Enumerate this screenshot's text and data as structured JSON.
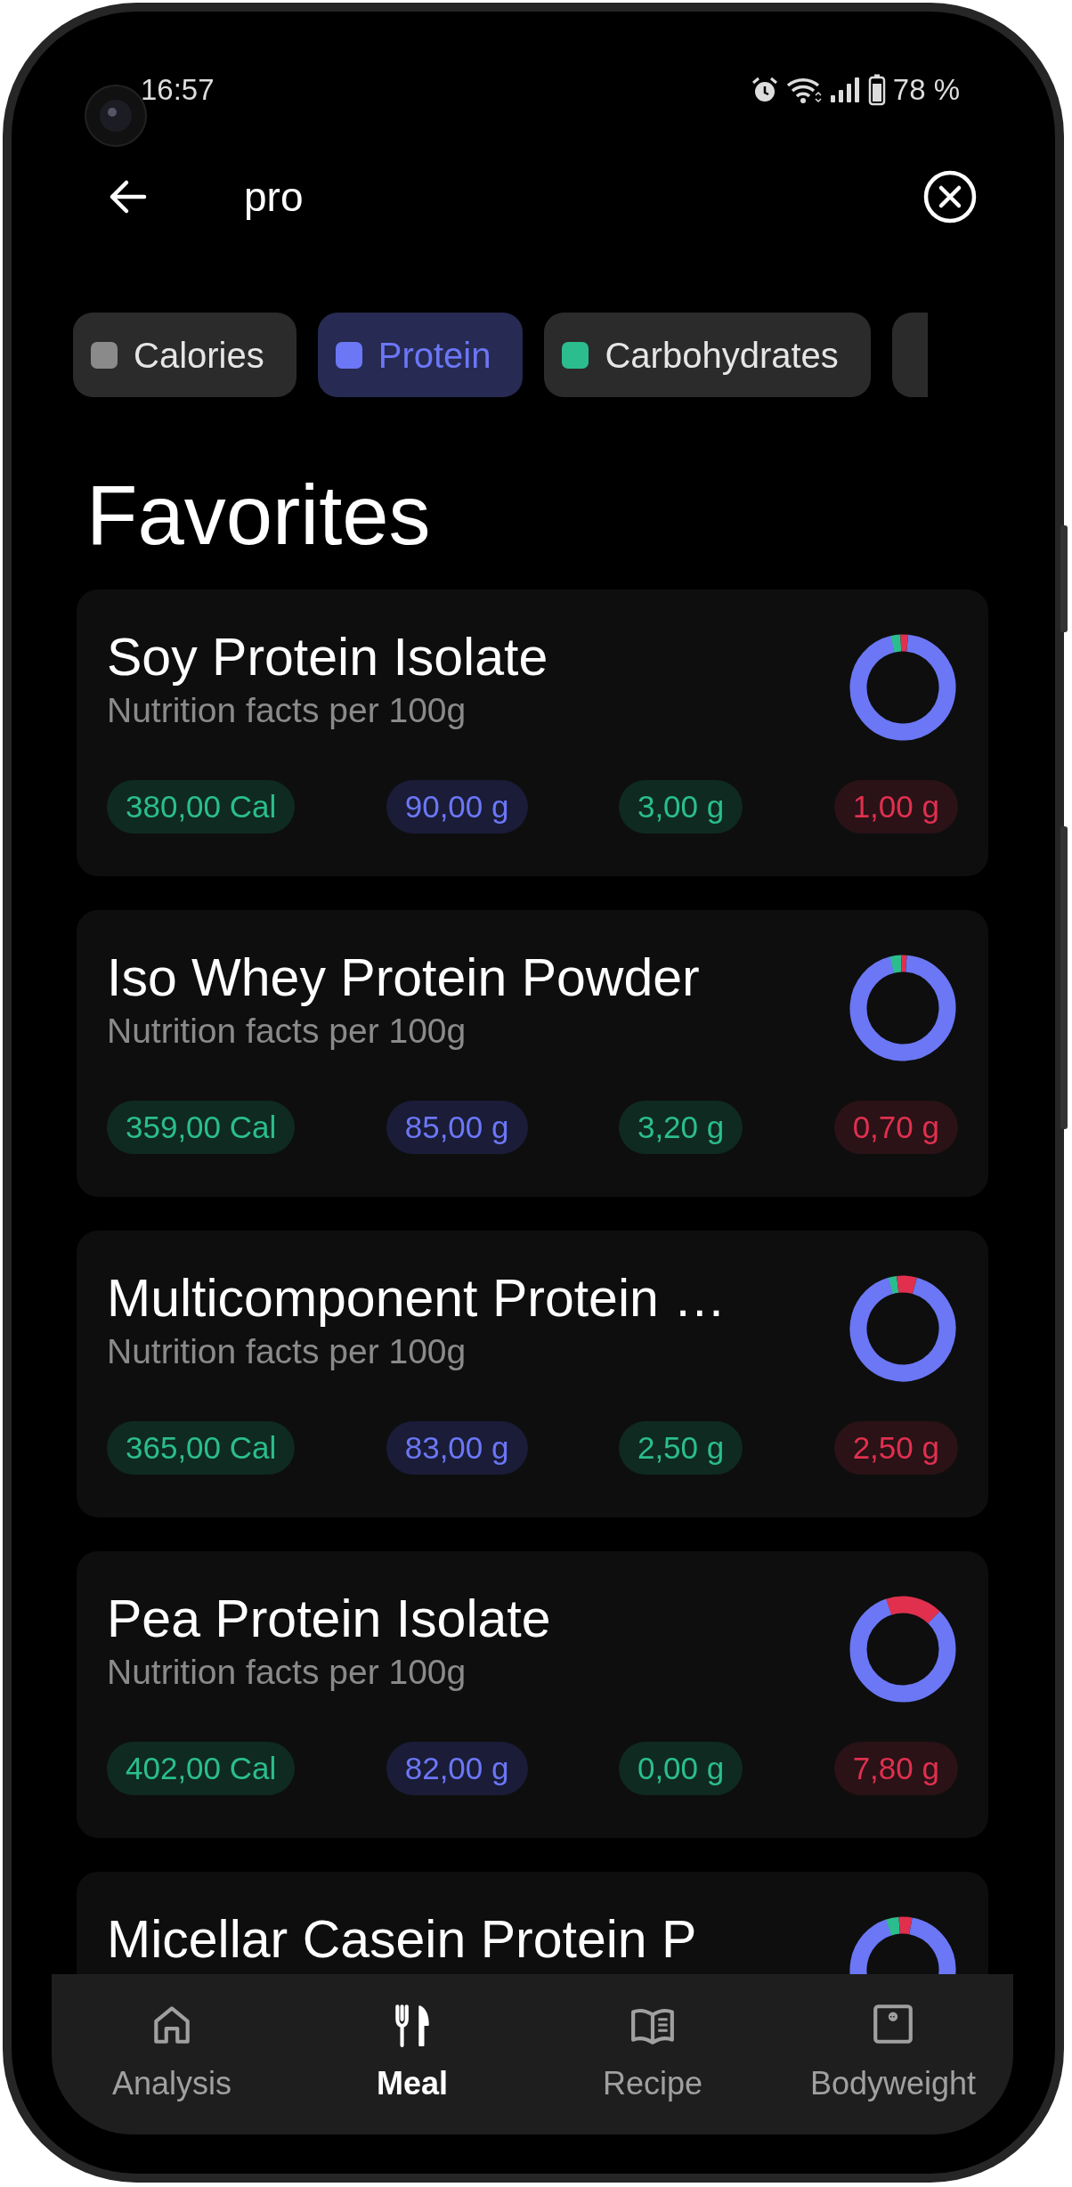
{
  "status_bar": {
    "time": "16:57",
    "battery": "78 %"
  },
  "search": {
    "value": "pro"
  },
  "filters": [
    {
      "label": "Calories",
      "color": "#8a8a8a",
      "selected": false
    },
    {
      "label": "Protein",
      "color": "#6b77f5",
      "selected": true
    },
    {
      "label": "Carbohydrates",
      "color": "#2bbd8e",
      "selected": false
    }
  ],
  "section_title": "Favorites",
  "foods": [
    {
      "name": "Soy Protein Isolate",
      "subtitle": "Nutrition facts per 100g",
      "values": [
        {
          "kind": "calories",
          "text": "380,00 Cal"
        },
        {
          "kind": "protein",
          "text": "90,00 g"
        },
        {
          "kind": "carbs",
          "text": "3,00 g"
        },
        {
          "kind": "fat",
          "text": "1,00 g"
        }
      ]
    },
    {
      "name": "Iso Whey Protein Powder",
      "subtitle": "Nutrition facts per 100g",
      "values": [
        {
          "kind": "calories",
          "text": "359,00 Cal"
        },
        {
          "kind": "protein",
          "text": "85,00 g"
        },
        {
          "kind": "carbs",
          "text": "3,20 g"
        },
        {
          "kind": "fat",
          "text": "0,70 g"
        }
      ]
    },
    {
      "name": "Multicomponent Protein …",
      "subtitle": "Nutrition facts per 100g",
      "values": [
        {
          "kind": "calories",
          "text": "365,00 Cal"
        },
        {
          "kind": "protein",
          "text": "83,00 g"
        },
        {
          "kind": "carbs",
          "text": "2,50 g"
        },
        {
          "kind": "fat",
          "text": "2,50 g"
        }
      ]
    },
    {
      "name": "Pea Protein Isolate",
      "subtitle": "Nutrition facts per 100g",
      "values": [
        {
          "kind": "calories",
          "text": "402,00 Cal"
        },
        {
          "kind": "protein",
          "text": "82,00 g"
        },
        {
          "kind": "carbs",
          "text": "0,00 g"
        },
        {
          "kind": "fat",
          "text": "7,80 g"
        }
      ]
    },
    {
      "name": "Micellar Casein Protein P"
    }
  ],
  "nav": [
    {
      "label": "Analysis",
      "kind": "home",
      "selected": false
    },
    {
      "label": "Meal",
      "kind": "meal",
      "selected": true
    },
    {
      "label": "Recipe",
      "kind": "book",
      "selected": false
    },
    {
      "label": "Bodyweight",
      "kind": "scale",
      "selected": false
    }
  ]
}
